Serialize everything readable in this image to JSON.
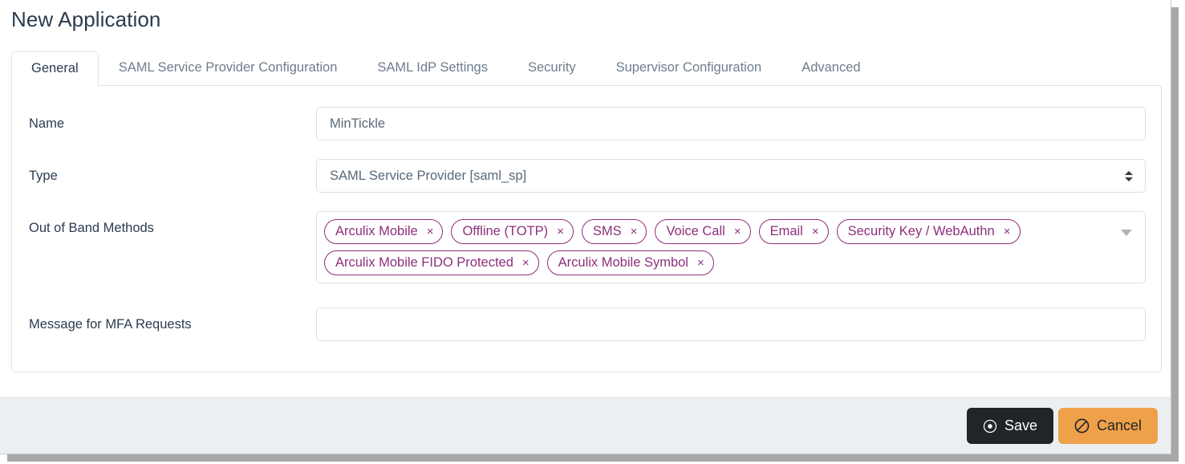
{
  "page": {
    "title": "New Application"
  },
  "tabs": [
    {
      "label": "General",
      "active": true
    },
    {
      "label": "SAML Service Provider Configuration",
      "active": false
    },
    {
      "label": "SAML IdP Settings",
      "active": false
    },
    {
      "label": "Security",
      "active": false
    },
    {
      "label": "Supervisor Configuration",
      "active": false
    },
    {
      "label": "Advanced",
      "active": false
    }
  ],
  "form": {
    "name": {
      "label": "Name",
      "value": "MinTickle"
    },
    "type": {
      "label": "Type",
      "value": "SAML Service Provider [saml_sp]",
      "icon": "select-updown-icon"
    },
    "out_of_band_methods": {
      "label": "Out of Band Methods",
      "caret_icon": "chevron-down-icon",
      "remove_icon": "×",
      "chips": [
        "Arculix Mobile",
        "Offline (TOTP)",
        "SMS",
        "Voice Call",
        "Email",
        "Security Key / WebAuthn",
        "Arculix Mobile FIDO Protected",
        "Arculix Mobile Symbol"
      ]
    },
    "mfa_message": {
      "label": "Message for MFA Requests",
      "value": "",
      "placeholder": ""
    }
  },
  "footer": {
    "save": {
      "label": "Save",
      "icon": "record-circle-icon"
    },
    "cancel": {
      "label": "Cancel",
      "icon": "no-entry-icon"
    }
  },
  "colors": {
    "chip_purple": "#8e2f7c",
    "save_bg": "#212529",
    "cancel_bg": "#efa14a",
    "text_dark": "#2b3c4e",
    "tab_inactive": "#6e7d8c",
    "footer_bg": "#eceff2",
    "border": "#dee2e6"
  }
}
